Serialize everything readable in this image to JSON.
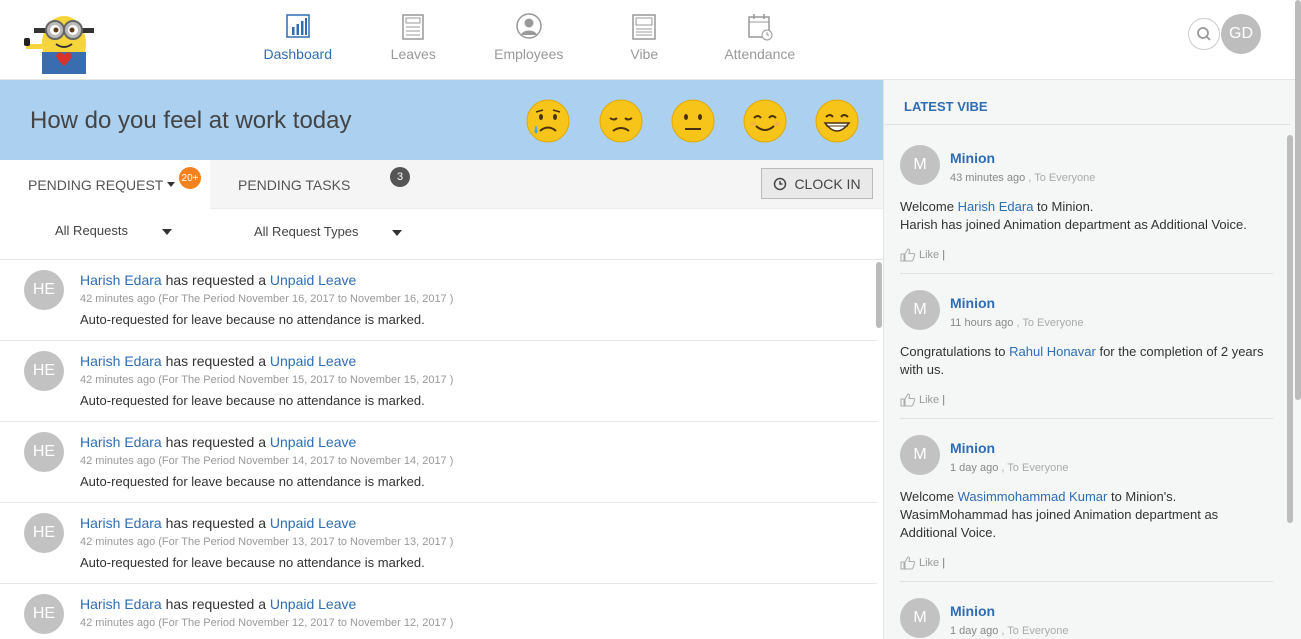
{
  "nav": {
    "items": [
      {
        "label": "Dashboard",
        "icon": "bar-chart-icon"
      },
      {
        "label": "Leaves",
        "icon": "document-list-icon"
      },
      {
        "label": "Employees",
        "icon": "user-circle-icon"
      },
      {
        "label": "Vibe",
        "icon": "newspaper-icon"
      },
      {
        "label": "Attendance",
        "icon": "calendar-clock-icon"
      }
    ],
    "active": "Dashboard"
  },
  "header": {
    "user_initials": "GD"
  },
  "mood": {
    "title": "How do you feel at work today",
    "options": [
      "sad-tear",
      "disappointed",
      "neutral",
      "smile",
      "grin"
    ]
  },
  "tabs": {
    "pending_request": "PENDING REQUEST",
    "pending_request_badge": "20+",
    "pending_tasks": "PENDING TASKS",
    "pending_tasks_badge": "3",
    "clock_in": "CLOCK IN"
  },
  "filters": {
    "requests": "All Requests",
    "request_types": "All Request Types"
  },
  "requests": [
    {
      "initials": "HE",
      "name": "Harish Edara",
      "action": "has requested a",
      "type": "Unpaid Leave",
      "meta": "42 minutes ago (For The Period November 16, 2017 to November 16, 2017 )",
      "message": "Auto-requested for leave because no attendance is marked."
    },
    {
      "initials": "HE",
      "name": "Harish Edara",
      "action": "has requested a",
      "type": "Unpaid Leave",
      "meta": "42 minutes ago (For The Period November 15, 2017 to November 15, 2017 )",
      "message": "Auto-requested for leave because no attendance is marked."
    },
    {
      "initials": "HE",
      "name": "Harish Edara",
      "action": "has requested a",
      "type": "Unpaid Leave",
      "meta": "42 minutes ago (For The Period November 14, 2017 to November 14, 2017 )",
      "message": "Auto-requested for leave because no attendance is marked."
    },
    {
      "initials": "HE",
      "name": "Harish Edara",
      "action": "has requested a",
      "type": "Unpaid Leave",
      "meta": "42 minutes ago (For The Period November 13, 2017 to November 13, 2017 )",
      "message": "Auto-requested for leave because no attendance is marked."
    },
    {
      "initials": "HE",
      "name": "Harish Edara",
      "action": "has requested a",
      "type": "Unpaid Leave",
      "meta": "42 minutes ago (For The Period November 12, 2017 to November 12, 2017 )",
      "message": ""
    }
  ],
  "vibe": {
    "heading": "LATEST VIBE",
    "posts": [
      {
        "initials": "M",
        "name": "Minion",
        "time": "43 minutes ago",
        "audience": ", To Everyone",
        "body": [
          "Welcome ",
          "Harish Edara",
          " to Minion.",
          "Harish has joined Animation department as Additional Voice."
        ],
        "like": "Like"
      },
      {
        "initials": "M",
        "name": "Minion",
        "time": "11 hours ago",
        "audience": ", To Everyone",
        "body": [
          "Congratulations to ",
          "Rahul Honavar",
          " for the completion of 2 years with us."
        ],
        "like": "Like"
      },
      {
        "initials": "M",
        "name": "Minion",
        "time": "1 day ago",
        "audience": ", To Everyone",
        "body": [
          "Welcome ",
          "Wasimmohammad Kumar",
          " to Minion's.",
          "WasimMohammad has joined Animation department as Additional Voice."
        ],
        "like": "Like"
      },
      {
        "initials": "M",
        "name": "Minion",
        "time": "1 day ago",
        "audience": ", To Everyone",
        "body": [],
        "like": ""
      }
    ]
  },
  "colors": {
    "accent": "#2f6db5",
    "mood_banner": "#acd0f0",
    "badge_orange": "#f5821f",
    "badge_dark": "#555555"
  }
}
